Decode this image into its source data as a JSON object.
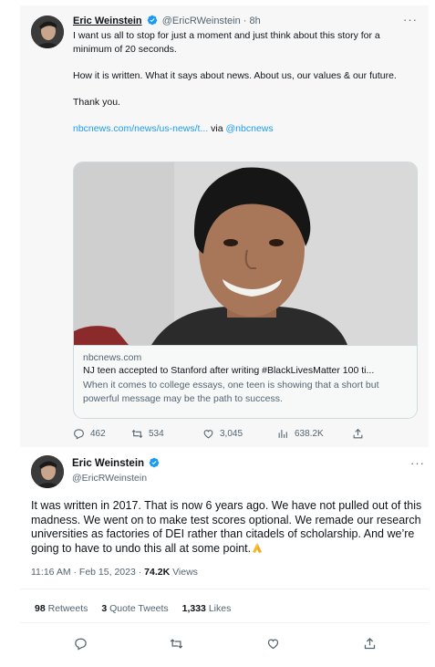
{
  "tweet1": {
    "author_name": "Eric Weinstein",
    "handle": "@EricRWeinstein",
    "separator": "·",
    "time": "8h",
    "text_lines": [
      "I want us all to stop for just a moment and just think about this story for a minimum of 20 seconds.",
      "How it is written. What it says about news. About us, our values & our future.",
      "Thank you."
    ],
    "link_text": "nbcnews.com/news/us-news/t...",
    "via_text": "via",
    "via_handle": "@nbcnews",
    "card": {
      "domain": "nbcnews.com",
      "title": "NJ teen accepted to Stanford after writing #BlackLivesMatter 100 ti...",
      "description": "When it comes to college essays, one teen is showing that a short but powerful message may be the path to success."
    },
    "actions": {
      "replies": "462",
      "retweets": "534",
      "likes": "3,045",
      "views": "638.2K"
    }
  },
  "tweet2": {
    "author_name": "Eric Weinstein",
    "handle": "@EricRWeinstein",
    "text": "It was written in 2017. That is now 6 years ago. We have not pulled out of this madness. We went on to make test scores optional. We remade our research universities as factories of DEI rather than citadels of scholarship. And we’re going to have to undo this all at some point.",
    "time": "11:16 AM · Feb 15, 2023 ·",
    "views_count": "74.2K",
    "views_label": "Views",
    "stats": {
      "retweets_count": "98",
      "retweets_label": "Retweets",
      "quotes_count": "3",
      "quotes_label": "Quote Tweets",
      "likes_count": "1,333",
      "likes_label": "Likes"
    }
  },
  "colors": {
    "accent": "#1d9bf0",
    "text": "#0f1419",
    "muted": "#536471",
    "border": "#cfd9de"
  },
  "icons": [
    "verified-badge-icon",
    "more-icon",
    "reply-icon",
    "retweet-icon",
    "like-icon",
    "views-icon",
    "share-icon",
    "folded-hands-emoji"
  ]
}
